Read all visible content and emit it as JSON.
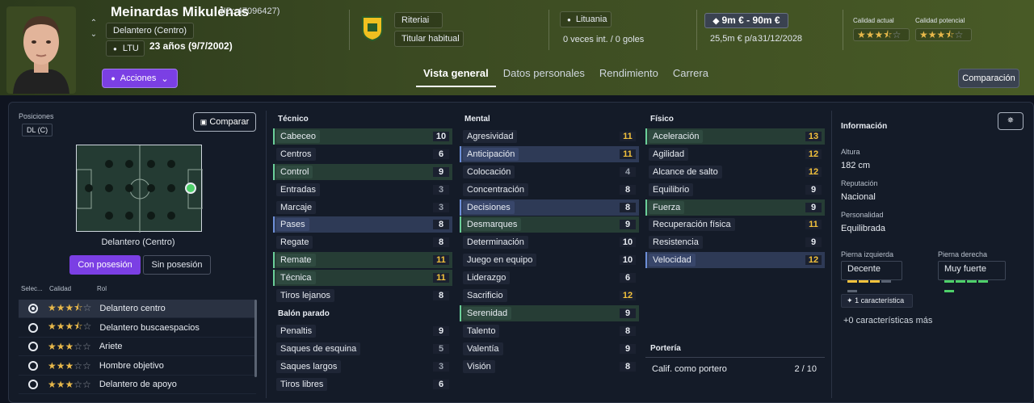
{
  "header": {
    "name": "Meinardas Mikulėnas",
    "id": "(ID: 47096427)",
    "position": "Delantero (Centro)",
    "nation_code": "LTU",
    "age": "23 años (9/7/2002)",
    "actions_label": "Acciones",
    "club": "Riteriai",
    "squad_status": "Titular habitual",
    "nationality": "Lituania",
    "caps": "0 veces int. / 0 goles",
    "value": "9m € - 90m €",
    "wage": "25,5m € p/a",
    "contract_end": "31/12/2028",
    "current_ability_label": "Calidad actual",
    "potential_ability_label": "Calidad potencial",
    "current_ability_stars": 3.5,
    "potential_ability_stars": 3.5,
    "compare_label": "Comparación"
  },
  "tabs": [
    "Vista general",
    "Datos personales",
    "Rendimiento",
    "Carrera"
  ],
  "positions": {
    "label": "Posiciones",
    "badge": "DL (C)",
    "compare_label": "Comparar",
    "selected_position": "Delantero (Centro)",
    "in_possession": "Con posesión",
    "out_possession": "Sin posesión"
  },
  "roles": {
    "headers": [
      "Selec...",
      "Calidad",
      "Rol"
    ],
    "items": [
      {
        "name": "Delantero centro",
        "stars": 3.5,
        "selected": true
      },
      {
        "name": "Delantero buscaespacios",
        "stars": 3.5,
        "selected": false
      },
      {
        "name": "Ariete",
        "stars": 3,
        "selected": false
      },
      {
        "name": "Hombre objetivo",
        "stars": 3,
        "selected": false
      },
      {
        "name": "Delantero de apoyo",
        "stars": 3,
        "selected": false
      }
    ]
  },
  "tecnico": {
    "title": "Técnico",
    "attrs": [
      {
        "n": "Cabeceo",
        "v": "10",
        "h": "g"
      },
      {
        "n": "Centros",
        "v": "6",
        "h": ""
      },
      {
        "n": "Control",
        "v": "9",
        "h": "g"
      },
      {
        "n": "Entradas",
        "v": "3",
        "h": ""
      },
      {
        "n": "Marcaje",
        "v": "3",
        "h": ""
      },
      {
        "n": "Pases",
        "v": "8",
        "h": "b"
      },
      {
        "n": "Regate",
        "v": "8",
        "h": ""
      },
      {
        "n": "Remate",
        "v": "11",
        "h": "g"
      },
      {
        "n": "Técnica",
        "v": "11",
        "h": "g"
      },
      {
        "n": "Tiros lejanos",
        "v": "8",
        "h": ""
      }
    ]
  },
  "balon_parado": {
    "title": "Balón parado",
    "attrs": [
      {
        "n": "Penaltis",
        "v": "9",
        "h": ""
      },
      {
        "n": "Saques de esquina",
        "v": "5",
        "h": ""
      },
      {
        "n": "Saques largos",
        "v": "3",
        "h": ""
      },
      {
        "n": "Tiros libres",
        "v": "6",
        "h": ""
      }
    ]
  },
  "mental": {
    "title": "Mental",
    "attrs": [
      {
        "n": "Agresividad",
        "v": "11",
        "h": ""
      },
      {
        "n": "Anticipación",
        "v": "11",
        "h": "b"
      },
      {
        "n": "Colocación",
        "v": "4",
        "h": ""
      },
      {
        "n": "Concentración",
        "v": "8",
        "h": ""
      },
      {
        "n": "Decisiones",
        "v": "8",
        "h": "b"
      },
      {
        "n": "Desmarques",
        "v": "9",
        "h": "g"
      },
      {
        "n": "Determinación",
        "v": "10",
        "h": ""
      },
      {
        "n": "Juego en equipo",
        "v": "10",
        "h": ""
      },
      {
        "n": "Liderazgo",
        "v": "6",
        "h": ""
      },
      {
        "n": "Sacrificio",
        "v": "12",
        "h": ""
      },
      {
        "n": "Serenidad",
        "v": "9",
        "h": "g"
      },
      {
        "n": "Talento",
        "v": "8",
        "h": ""
      },
      {
        "n": "Valentía",
        "v": "9",
        "h": ""
      },
      {
        "n": "Visión",
        "v": "8",
        "h": ""
      }
    ]
  },
  "fisico": {
    "title": "Físico",
    "attrs": [
      {
        "n": "Aceleración",
        "v": "13",
        "h": "g"
      },
      {
        "n": "Agilidad",
        "v": "12",
        "h": ""
      },
      {
        "n": "Alcance de salto",
        "v": "12",
        "h": ""
      },
      {
        "n": "Equilibrio",
        "v": "9",
        "h": ""
      },
      {
        "n": "Fuerza",
        "v": "9",
        "h": "g"
      },
      {
        "n": "Recuperación física",
        "v": "11",
        "h": ""
      },
      {
        "n": "Resistencia",
        "v": "9",
        "h": ""
      },
      {
        "n": "Velocidad",
        "v": "12",
        "h": "b"
      }
    ]
  },
  "porteria": {
    "title": "Portería",
    "label": "Calif. como portero",
    "value": "2 / 10"
  },
  "info": {
    "title": "Información",
    "height_label": "Altura",
    "height": "182 cm",
    "reputation_label": "Reputación",
    "reputation": "Nacional",
    "personality_label": "Personalidad",
    "personality": "Equilibrada",
    "left_foot_label": "Pierna izquierda",
    "left_foot": "Decente",
    "right_foot_label": "Pierna derecha",
    "right_foot": "Muy fuerte",
    "traits_badge": "1 característica",
    "traits_more": "+0 características más"
  },
  "colors": {
    "accent": "#7b3fe4",
    "high": "#f3c23c",
    "star": "#e8b84a"
  }
}
